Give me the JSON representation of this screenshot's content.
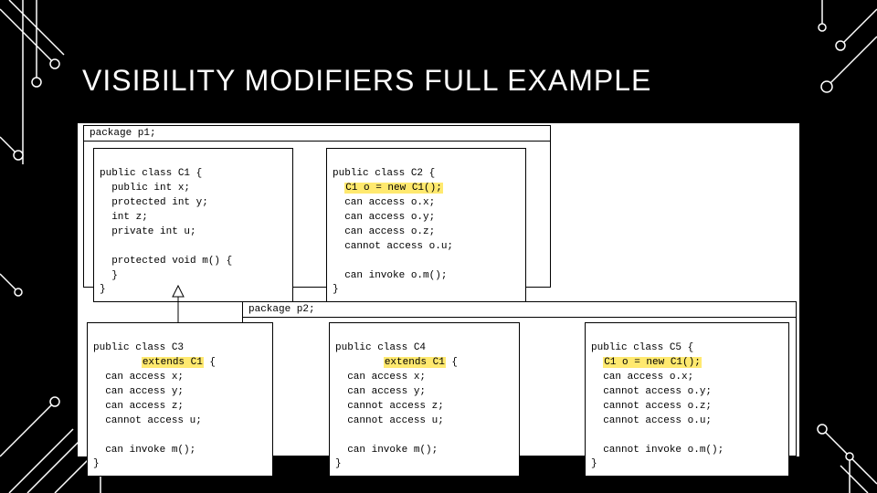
{
  "title": "VISIBILITY MODIFIERS FULL EXAMPLE",
  "p1": {
    "label": "package p1;",
    "c1": {
      "l1": "public class C1 {",
      "l2": "  public int x;",
      "l3": "  protected int y;",
      "l4": "  int z;",
      "l5": "  private int u;",
      "l6": "",
      "l7": "  protected void m() {",
      "l8": "  }",
      "l9": "}"
    },
    "c2": {
      "l1": "public class C2 {",
      "hl": "C1 o = new C1();",
      "l3": "  can access o.x;",
      "l4": "  can access o.y;",
      "l5": "  can access o.z;",
      "l6": "  cannot access o.u;",
      "l7": "",
      "l8": "  can invoke o.m();",
      "l9": "}"
    }
  },
  "p2": {
    "label": "package p2;",
    "c3": {
      "l1": "public class C3",
      "hl": "extends C1",
      "post": " {",
      "l3": "  can access x;",
      "l4": "  can access y;",
      "l5": "  can access z;",
      "l6": "  cannot access u;",
      "l7": "",
      "l8": "  can invoke m();",
      "l9": "}"
    },
    "c4": {
      "l1": "public class C4",
      "hl": "extends C1",
      "post": " {",
      "l3": "  can access x;",
      "l4": "  can access y;",
      "l5": "  cannot access z;",
      "l6": "  cannot access u;",
      "l7": "",
      "l8": "  can invoke m();",
      "l9": "}"
    },
    "c5": {
      "l1": "public class C5 {",
      "hl": "C1 o = new C1();",
      "l3": "  can access o.x;",
      "l4": "  cannot access o.y;",
      "l5": "  cannot access o.z;",
      "l6": "  cannot access o.u;",
      "l7": "",
      "l8": "  cannot invoke o.m();",
      "l9": "}"
    }
  }
}
